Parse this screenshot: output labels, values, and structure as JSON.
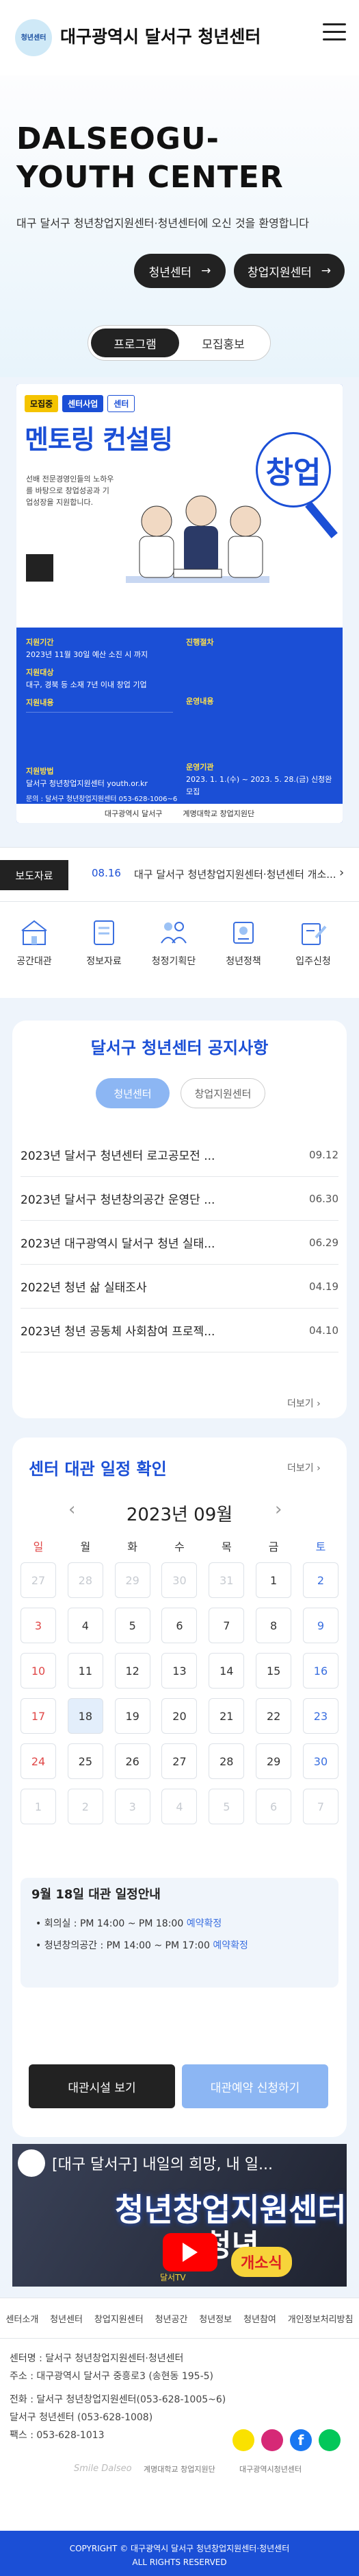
{
  "header": {
    "logo_text": "청년센터",
    "title": "대구광역시 달서구 청년센터",
    "menu_icon": "hamburger-menu-icon"
  },
  "hero": {
    "title_line1": "DALSEOGU-",
    "title_line2": "YOUTH CENTER",
    "subtitle": "대구 달서구 청년창업지원센터·청년센터에 오신 것을 환영합니다",
    "btn_youth": "청년센터",
    "btn_startup": "창업지원센터",
    "arrow": "→"
  },
  "tabs": {
    "program": "프로그램",
    "recruit": "모집홍보"
  },
  "poster": {
    "badge1": "모집중",
    "badge2": "센터사업",
    "badge3": "센터",
    "headline": "멘토링 컨설팅",
    "big_word": "창업",
    "intro": "선배 전문경영인들의 노하우를 바탕으로 창업성공과 기업성장을 지원합니다.",
    "col1_h1": "지원기간",
    "col1_t1": "2023년 11월 30일 예산 소진 시 까지",
    "col1_h2": "지원대상",
    "col1_t2": "대구, 경북 등 소재 7년 이내 창업 기업",
    "col1_h3": "지원내용",
    "col1_h4": "지원방법",
    "col1_t4": "달서구 청년창업지원센터 youth.or.kr",
    "col2_h1": "진행절차",
    "col2_h2": "운영내용",
    "col2_h3": "운영기관",
    "col2_t3": "2023. 1. 1.(수) ~ 2023. 5. 28.(금) 신청완 모집",
    "contact": "문의 : 달서구 청년창업지원센터 053-628-1006~6",
    "footer_logo1": "대구광역시 달서구",
    "footer_logo2": "계명대학교 창업지원단"
  },
  "notice_bar": {
    "label": "보도자료",
    "date": "08.16",
    "text": "대구 달서구 청년창업지원센터·청년센터 개소..."
  },
  "quick_menu": [
    {
      "label": "공간대관",
      "icon": "space-rental-icon"
    },
    {
      "label": "정보자료",
      "icon": "info-data-icon"
    },
    {
      "label": "청정기획단",
      "icon": "planning-group-icon"
    },
    {
      "label": "청년정책",
      "icon": "youth-policy-icon"
    },
    {
      "label": "입주신청",
      "icon": "move-in-apply-icon"
    }
  ],
  "notices": {
    "title": "달서구 청년센터 공지사항",
    "tab_active": "청년센터",
    "tab_inactive": "창업지원센터",
    "items": [
      {
        "title": "2023년 달서구 청년센터 로고공모전 ...",
        "date": "09.12"
      },
      {
        "title": "2023년 달서구 청년창의공간 운영단 ...",
        "date": "06.30"
      },
      {
        "title": "2023년 대구광역시 달서구 청년 실태...",
        "date": "06.29"
      },
      {
        "title": "2022년 청년 삶 실태조사",
        "date": "04.19"
      },
      {
        "title": "2023년 청년 공동체 사회참여 프로젝...",
        "date": "04.10"
      }
    ],
    "more": "더보기"
  },
  "calendar": {
    "title": "센터 대관 일정 확인",
    "more": "더보기",
    "month": "2023년 09월",
    "weekdays": [
      "일",
      "월",
      "화",
      "수",
      "목",
      "금",
      "토"
    ],
    "weeks": [
      [
        "27",
        "28",
        "29",
        "30",
        "31",
        "1",
        "2"
      ],
      [
        "3",
        "4",
        "5",
        "6",
        "7",
        "8",
        "9"
      ],
      [
        "10",
        "11",
        "12",
        "13",
        "14",
        "15",
        "16"
      ],
      [
        "17",
        "18",
        "19",
        "20",
        "21",
        "22",
        "23"
      ],
      [
        "24",
        "25",
        "26",
        "27",
        "28",
        "29",
        "30"
      ],
      [
        "1",
        "2",
        "3",
        "4",
        "5",
        "6",
        "7"
      ]
    ],
    "schedule_title": "9월 18일 대관 일정안내",
    "schedule": [
      {
        "place": "• 회의실 : PM 14:00 ~ PM 18:00",
        "status": "예약확정"
      },
      {
        "place": "• 청년창의공간 : PM 14:00 ~ PM 17:00",
        "status": "예약확정"
      }
    ],
    "btn_view": "대관시설 보기",
    "btn_reserve": "대관예약 신청하기"
  },
  "video": {
    "title": "[대구 달서구] 내일의 희망, 내 일...",
    "big1": "청년창업지원센터",
    "big2": "청년",
    "badge": "개소식",
    "watermark": "달서TV"
  },
  "footer": {
    "nav": [
      "센터소개",
      "청년센터",
      "창업지원센터",
      "청년공간",
      "청년정보",
      "청년참여",
      "개인정보처리방침"
    ],
    "line1": "센터명 : 달서구 청년창업지원센터·청년센터",
    "line2": "주소 : 대구광역시 달서구 중흥로3 (송현동 195-5)",
    "line3": "전화 : 달서구 청년창업지원센터(053-628-1005~6)",
    "line4": "달서구 청년센터 (053-628-1008)",
    "line5": "팩스 : 053-628-1013",
    "logo1": "Smile Dalseo",
    "logo2": "계명대학교 창업지원단",
    "logo3": "대구광역시청년센터",
    "copyright1": "COPYRIGHT © 대구광역시 달서구 청년창업지원센터·청년센터",
    "copyright2": "ALL RIGHTS RESERVED"
  },
  "colors": {
    "brand_blue": "#1b4fd6",
    "dark": "#222222",
    "sunday": "#e04848",
    "saturday": "#3a6fe0"
  }
}
